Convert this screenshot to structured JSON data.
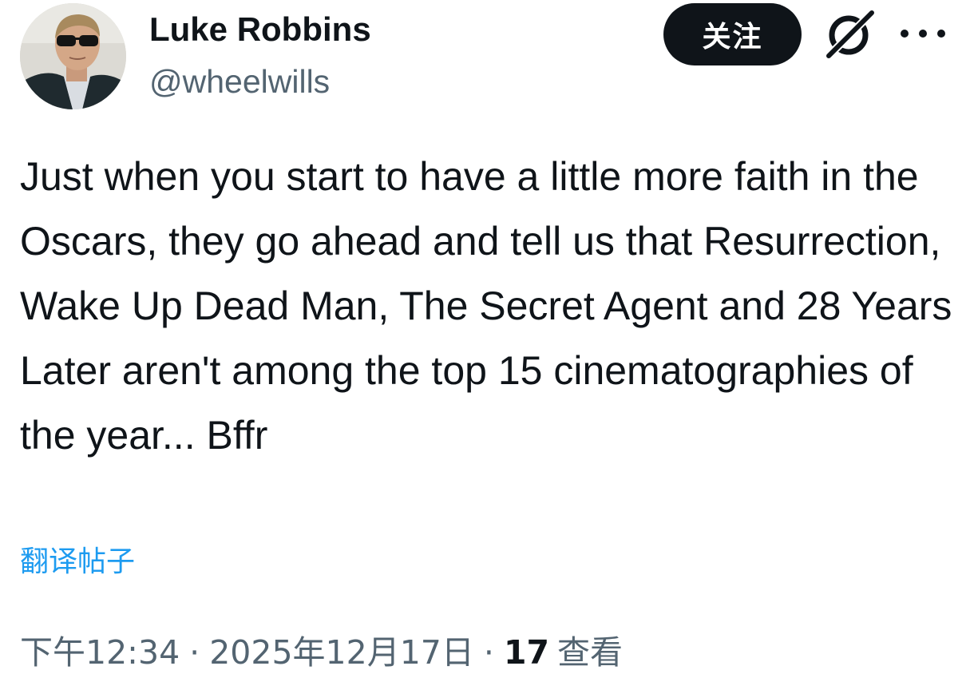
{
  "user": {
    "display_name": "Luke Robbins",
    "handle": "@wheelwills"
  },
  "actions": {
    "follow_label": "关注",
    "grok_icon": "grok-icon",
    "more_icon": "more-icon"
  },
  "tweet": {
    "text": "Just when you start to have a little more faith in the Oscars, they go ahead and tell us that Resurrection, Wake Up Dead Man, The Secret Agent and 28 Years Later aren't among the top 15 cinematographies of the year... Bffr",
    "translate_label": "翻译帖子"
  },
  "meta": {
    "time": "下午12:34",
    "separator": "·",
    "date": "2025年12月17日",
    "views_count": "17",
    "views_label": "查看"
  },
  "colors": {
    "text_primary": "#0f1419",
    "text_secondary": "#536471",
    "link": "#1d9bf0",
    "button_bg": "#0f1419"
  }
}
